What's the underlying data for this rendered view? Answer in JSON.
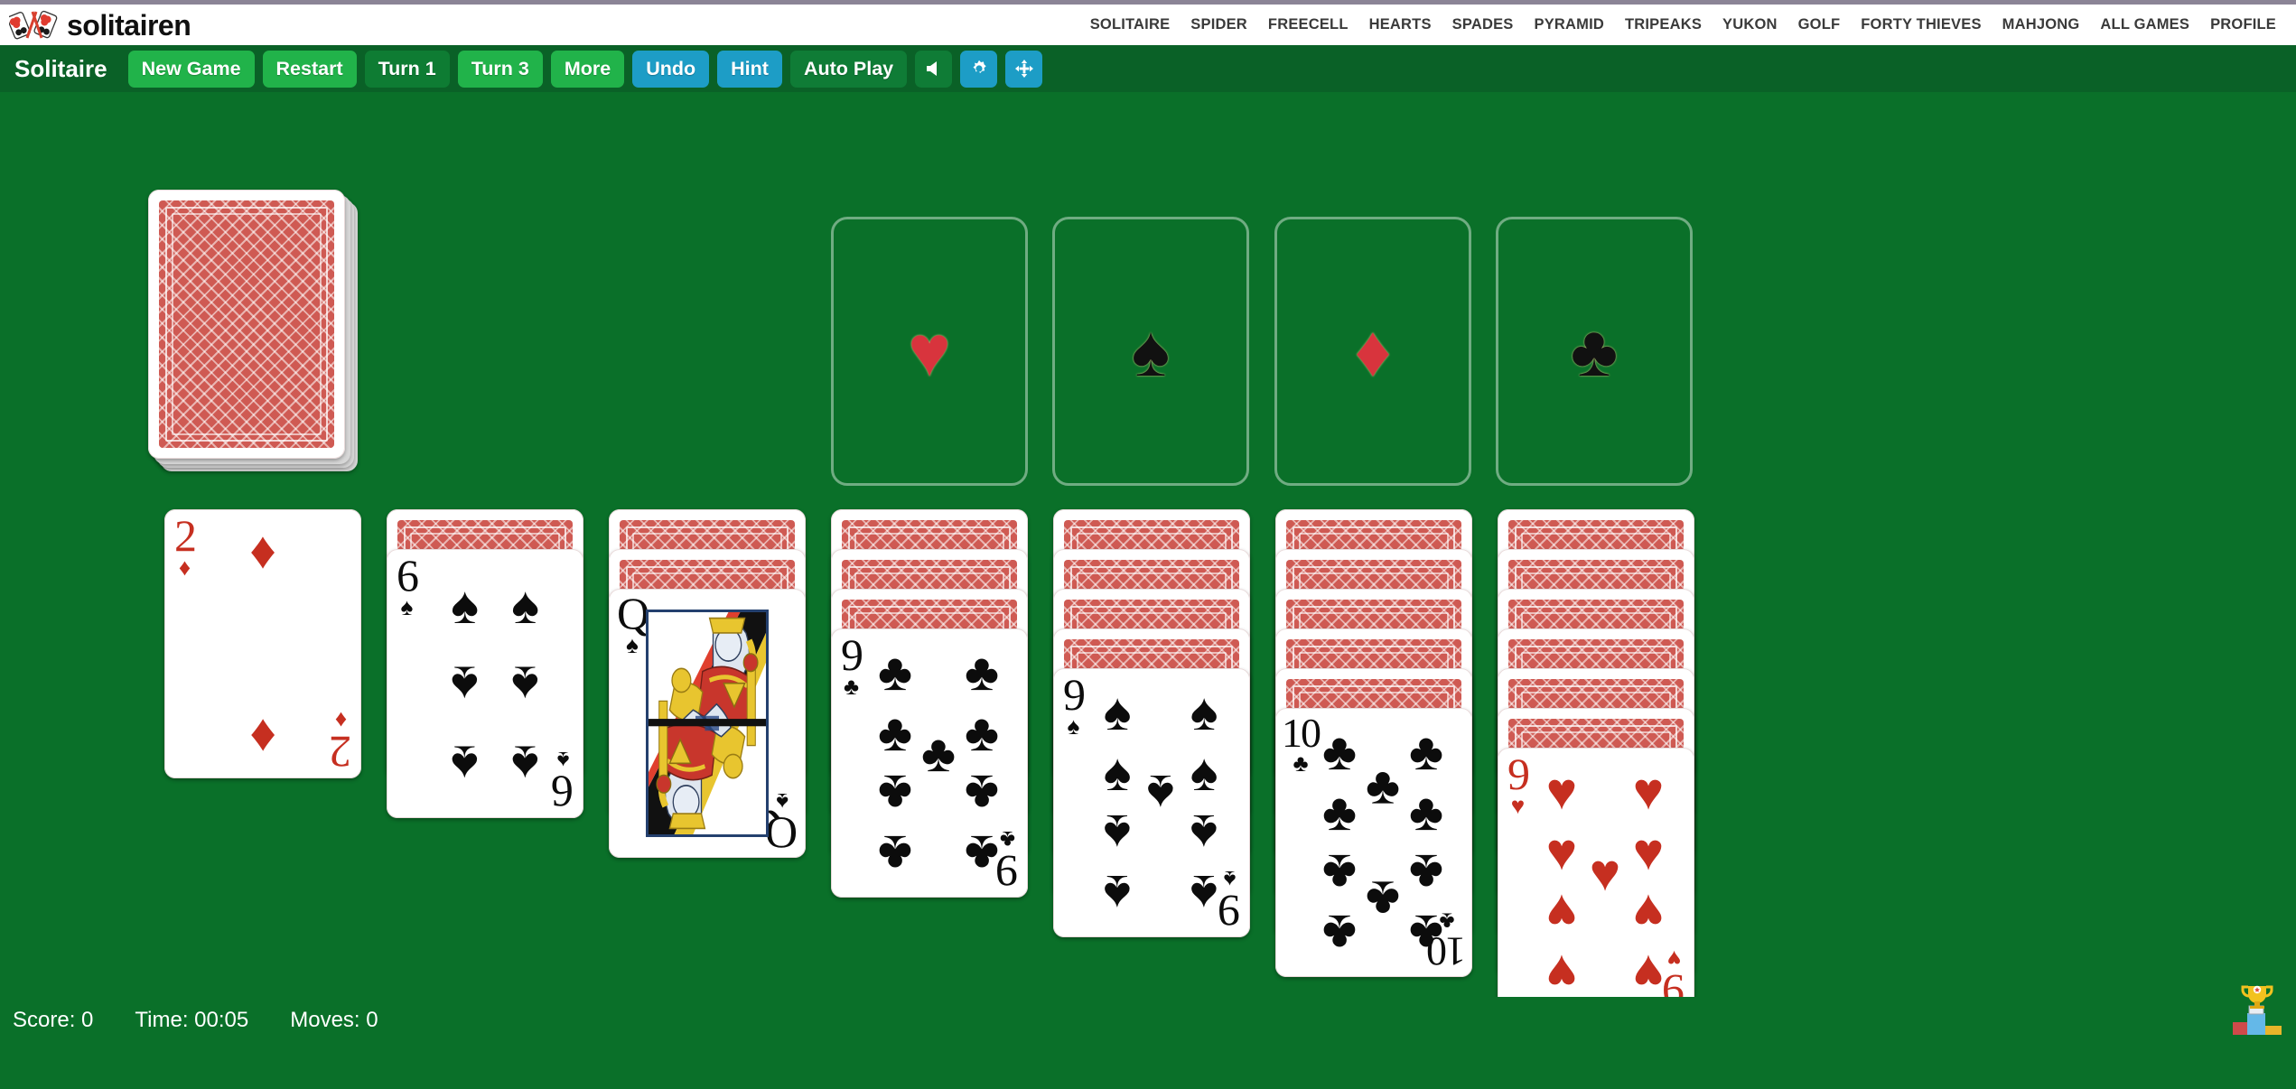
{
  "site": {
    "brand": "solitairen",
    "logo_icon": "cards-logo-icon",
    "nav": [
      {
        "label": "SOLITAIRE",
        "name": "nav-solitaire"
      },
      {
        "label": "SPIDER",
        "name": "nav-spider"
      },
      {
        "label": "FREECELL",
        "name": "nav-freecell"
      },
      {
        "label": "HEARTS",
        "name": "nav-hearts"
      },
      {
        "label": "SPADES",
        "name": "nav-spades"
      },
      {
        "label": "PYRAMID",
        "name": "nav-pyramid"
      },
      {
        "label": "TRIPEAKS",
        "name": "nav-tripeaks"
      },
      {
        "label": "YUKON",
        "name": "nav-yukon"
      },
      {
        "label": "GOLF",
        "name": "nav-golf"
      },
      {
        "label": "FORTY THIEVES",
        "name": "nav-forty-thieves"
      },
      {
        "label": "MAHJONG",
        "name": "nav-mahjong"
      },
      {
        "label": "ALL GAMES",
        "name": "nav-all-games"
      },
      {
        "label": "PROFILE",
        "name": "nav-profile"
      }
    ]
  },
  "toolbar": {
    "game_title": "Solitaire",
    "new_game": "New Game",
    "restart": "Restart",
    "turn1": "Turn 1",
    "turn3": "Turn 3",
    "more": "More",
    "undo": "Undo",
    "hint": "Hint",
    "auto_play": "Auto Play",
    "sound_icon": "speaker-icon",
    "settings_icon": "gear-icon",
    "fullscreen_icon": "fullscreen-arrows-icon"
  },
  "colors": {
    "table_green": "#0a7029",
    "toolbar_green": "#0a6127",
    "btn_green": "#21b34a",
    "btn_green_dark": "#0e7c33",
    "btn_teal": "#1d9dc6",
    "card_back_red": "#cf5a53",
    "suit_red": "#c62f20",
    "suit_black": "#0c0c0c"
  },
  "board": {
    "stock": {
      "name": "stock-pile",
      "face_down": true,
      "cards_remaining_look": "thick-stack"
    },
    "waste": {
      "name": "waste-pile",
      "empty": true
    },
    "foundations": [
      {
        "name": "foundation-hearts",
        "suit": "hearts",
        "glyph": "♥",
        "color": "red",
        "empty": true
      },
      {
        "name": "foundation-spades",
        "suit": "spades",
        "glyph": "♠",
        "color": "black",
        "empty": true
      },
      {
        "name": "foundation-diamonds",
        "suit": "diamonds",
        "glyph": "♦",
        "color": "red",
        "empty": true
      },
      {
        "name": "foundation-clubs",
        "suit": "clubs",
        "glyph": "♣",
        "color": "black",
        "empty": true
      }
    ],
    "tableau": [
      {
        "name": "tableau-column-1",
        "face_down": 0,
        "top_card": {
          "rank": "2",
          "suit": "diamonds",
          "glyph": "♦",
          "color": "red",
          "pip_count": 2
        }
      },
      {
        "name": "tableau-column-2",
        "face_down": 1,
        "top_card": {
          "rank": "6",
          "suit": "spades",
          "glyph": "♠",
          "color": "black",
          "pip_count": 6
        }
      },
      {
        "name": "tableau-column-3",
        "face_down": 2,
        "top_card": {
          "rank": "Q",
          "suit": "spades",
          "glyph": "♠",
          "color": "black",
          "pip_count": 0,
          "court": true
        }
      },
      {
        "name": "tableau-column-4",
        "face_down": 3,
        "top_card": {
          "rank": "9",
          "suit": "clubs",
          "glyph": "♣",
          "color": "black",
          "pip_count": 9
        }
      },
      {
        "name": "tableau-column-5",
        "face_down": 4,
        "top_card": {
          "rank": "9",
          "suit": "spades",
          "glyph": "♠",
          "color": "black",
          "pip_count": 9
        }
      },
      {
        "name": "tableau-column-6",
        "face_down": 5,
        "top_card": {
          "rank": "10",
          "suit": "clubs",
          "glyph": "♣",
          "color": "black",
          "pip_count": 10
        }
      },
      {
        "name": "tableau-column-7",
        "face_down": 6,
        "top_card": {
          "rank": "9",
          "suit": "hearts",
          "glyph": "♥",
          "color": "red",
          "pip_count": 9
        }
      }
    ]
  },
  "status": {
    "score_label": "Score: 0",
    "time_label": "Time: 00:05",
    "moves_label": "Moves: 0",
    "leaderboard_icon": "trophy-podium-icon"
  }
}
